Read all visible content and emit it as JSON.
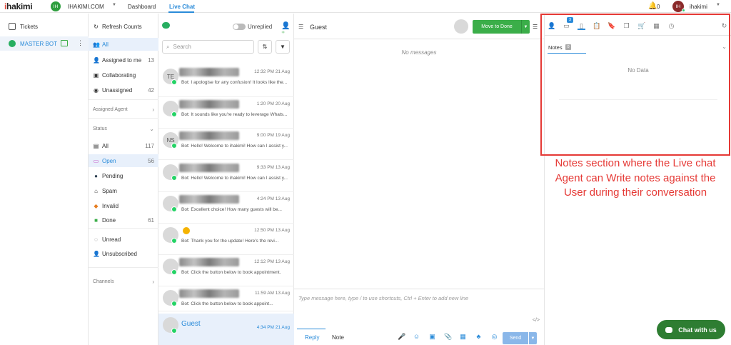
{
  "brand": {
    "logo": "ihakimi",
    "org_initials": "IH",
    "org_name": "IHAKIMI.COM"
  },
  "nav": {
    "dashboard": "Dashboard",
    "live_chat": "Live Chat"
  },
  "user": {
    "notif_count": "0",
    "initials": "IH",
    "name": "ihakimi"
  },
  "rail": {
    "tickets": "Tickets",
    "bot": "MASTER BOT"
  },
  "filters": {
    "refresh": "Refresh Counts",
    "all": "All",
    "assigned_to_me": "Assigned to me",
    "assigned_to_me_count": "13",
    "collaborating": "Collaborating",
    "unassigned": "Unassigned",
    "unassigned_count": "42",
    "assigned_agent": "Assigned Agent",
    "status": "Status",
    "status_all": "All",
    "status_all_count": "117",
    "open": "Open",
    "open_count": "56",
    "pending": "Pending",
    "spam": "Spam",
    "invalid": "Invalid",
    "done": "Done",
    "done_count": "61",
    "unread": "Unread",
    "unsubscribed": "Unsubscribed",
    "channels": "Channels"
  },
  "list": {
    "unreplied": "Unreplied",
    "search_placeholder": "Search",
    "conversations": [
      {
        "initials": "TE",
        "time": "12:32 PM 21 Aug",
        "snippet": "Bot: I apologise for any confusion! It looks like the..."
      },
      {
        "initials": "",
        "time": "1:20 PM 20 Aug",
        "snippet": "Bot: It sounds like you're ready to leverage Whats..."
      },
      {
        "initials": "NS",
        "time": "9:00 PM 19 Aug",
        "snippet": "Bot: Hello! Welcome to ihakimi! How can I assist y..."
      },
      {
        "initials": "",
        "time": "9:33 PM 13 Aug",
        "snippet": "Bot: Hello! Welcome to ihakimi! How can I assist y..."
      },
      {
        "initials": "",
        "time": "4:24 PM 13 Aug",
        "snippet": "Bot: Excellent choice! How many guests will be..."
      },
      {
        "initials": "",
        "time": "12:50 PM 13 Aug",
        "snippet": "Bot: Thank you for the update! Here's the revi..."
      },
      {
        "initials": "",
        "time": "12:12 PM 13 Aug",
        "snippet": "Bot: Click the button below to book appointment."
      },
      {
        "initials": "",
        "time": "11:59 AM 13 Aug",
        "snippet": "Bot: Click the button below to book appoint..."
      },
      {
        "initials": "",
        "name": "Guest",
        "time": "4:34 PM 21 Aug",
        "snippet": ""
      }
    ]
  },
  "chat": {
    "title": "Guest",
    "move_to_done": "Move to Done",
    "no_messages": "No messages",
    "composer_placeholder": "Type message here, type / to use shortcuts, Ctrl + Enter to add new line",
    "reply_tab": "Reply",
    "note_tab": "Note",
    "send": "Send"
  },
  "panel": {
    "tab_badge": "3",
    "notes_label": "Notes",
    "notes_count": "0",
    "no_data": "No Data"
  },
  "annotation": "Notes section where the Live chat Agent can Write notes against the User during their conversation",
  "chat_widget": "Chat with us",
  "colors": {
    "accent": "#2a8bd9",
    "green": "#3bae49",
    "annotation_red": "#e53935"
  }
}
